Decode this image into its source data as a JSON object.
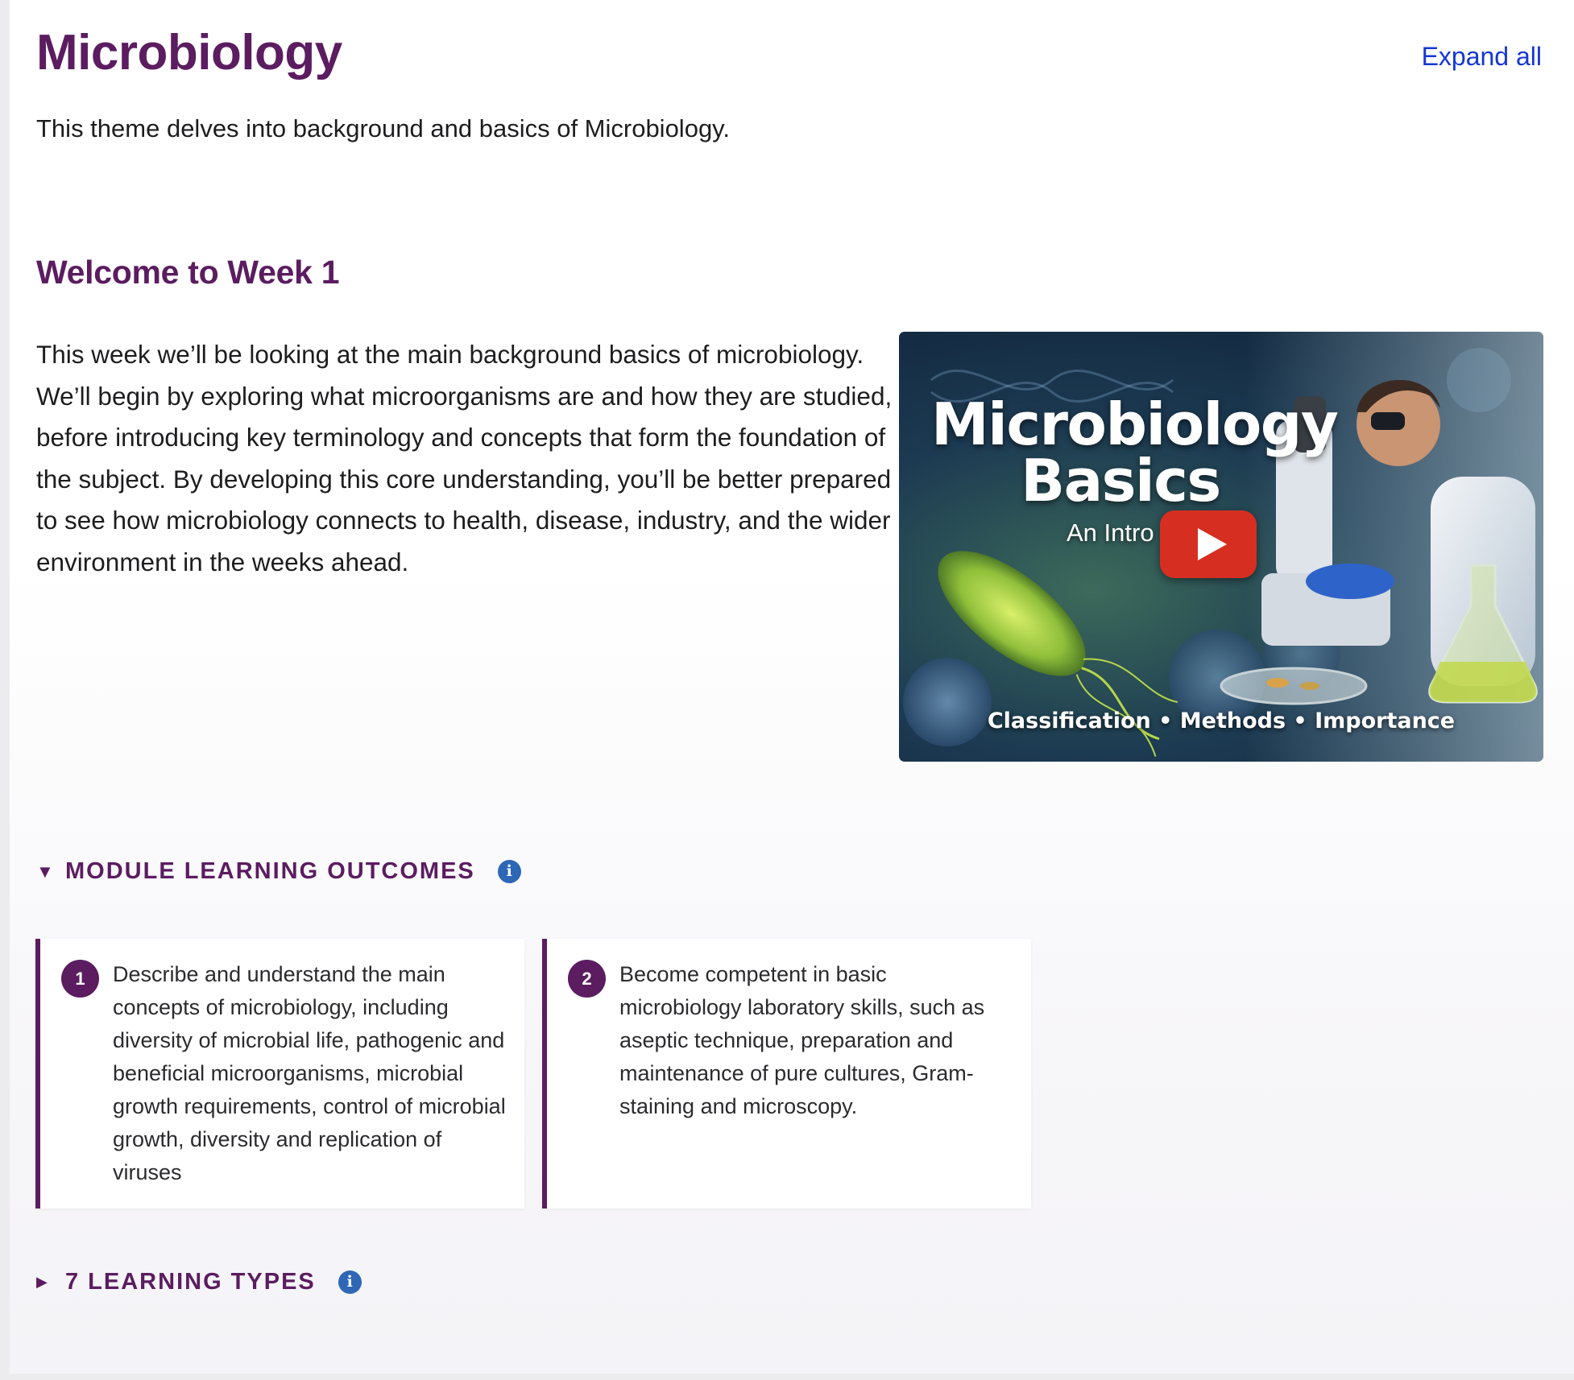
{
  "course": {
    "title": "Microbiology",
    "description": "This theme delves into background and basics of Microbiology.",
    "expand_all_label": "Expand all"
  },
  "week": {
    "title": "Welcome to Week 1",
    "intro": "This week we’ll be looking at the main background basics of microbiology. We’ll begin by exploring what microorganisms are and how they are studied, before introducing key terminology and concepts that form the foundation of the subject. By developing this core understanding, you’ll be better prepared to see how microbiology connects to health, disease, industry, and the wider environment in the weeks ahead."
  },
  "video": {
    "title_line1": "Microbiology",
    "title_line2": "Basics",
    "subtitle": "An Intro",
    "tags": "Classification • Methods • Importance"
  },
  "learning_outcomes": {
    "label": "MODULE LEARNING OUTCOMES",
    "expanded": true,
    "items": [
      {
        "number": "1",
        "text": "Describe and understand the main concepts of microbiology, including diversity of microbial life, pathogenic and beneficial microorganisms, microbial growth requirements, control of microbial growth, diversity and replication of viruses"
      },
      {
        "number": "2",
        "text": "Become competent in basic microbiology laboratory skills, such as aseptic technique, preparation and maintenance of pure cultures, Gram-staining and microscopy."
      }
    ]
  },
  "learning_types": {
    "label": "7 LEARNING TYPES",
    "expanded": false
  },
  "icons": {
    "expanded_caret": "▼",
    "collapsed_caret": "▶",
    "info": "i"
  },
  "colors": {
    "brand_purple": "#5b1c60",
    "link_blue": "#1437d4",
    "info_blue": "#2d67b5",
    "play_red": "#d62f21"
  }
}
